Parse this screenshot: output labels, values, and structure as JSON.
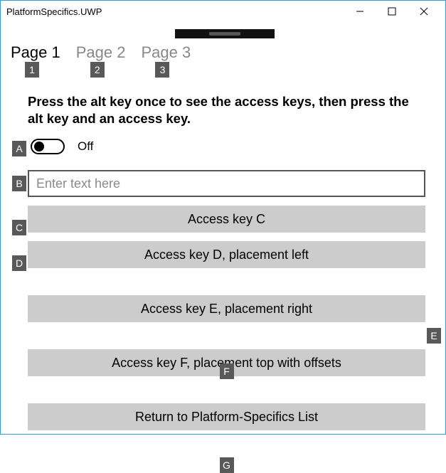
{
  "window": {
    "title": "PlatformSpecifics.UWP"
  },
  "tabs": [
    {
      "label": "Page 1",
      "key": "1"
    },
    {
      "label": "Page 2",
      "key": "2"
    },
    {
      "label": "Page 3",
      "key": "3"
    }
  ],
  "instruction": "Press the alt key once to see the access keys, then press the alt key and an access key.",
  "toggle": {
    "key": "A",
    "state_label": "Off"
  },
  "textbox": {
    "key": "B",
    "placeholder": "Enter text here"
  },
  "buttons": {
    "c": {
      "key": "C",
      "label": "Access key C"
    },
    "d": {
      "key": "D",
      "label": "Access key D, placement left"
    },
    "e": {
      "key": "E",
      "label": "Access key E, placement right"
    },
    "f": {
      "key": "F",
      "label": "Access key F, placement top with offsets"
    },
    "g": {
      "key": "G",
      "label": "Return to Platform-Specifics List"
    }
  }
}
